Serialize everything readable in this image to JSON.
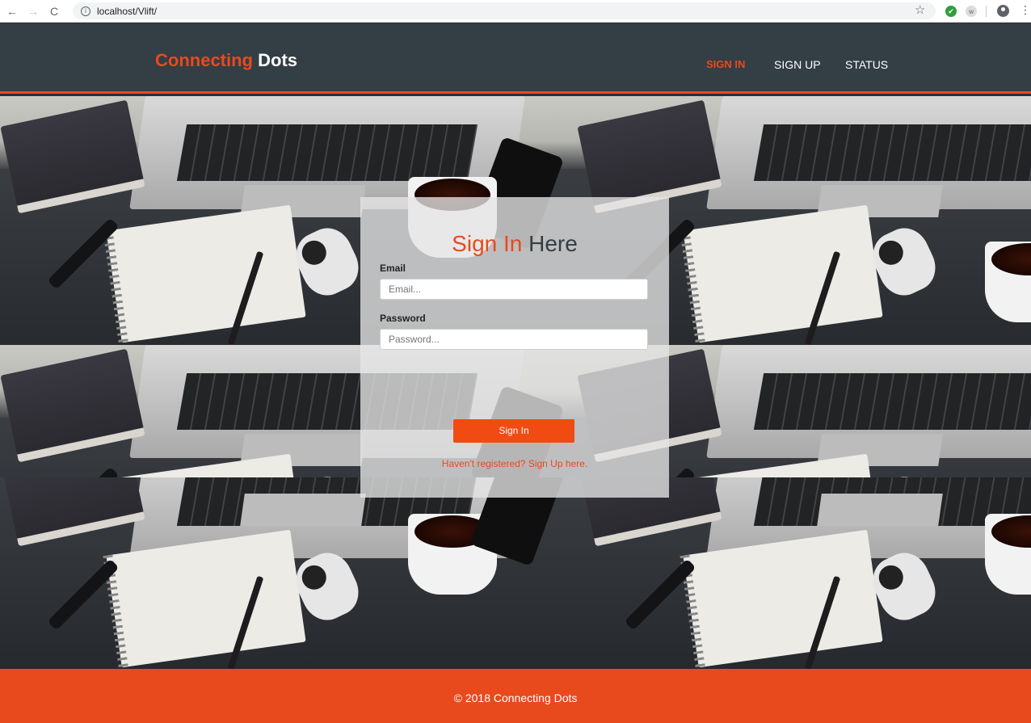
{
  "browser": {
    "url": "localhost/Vlift/",
    "back_icon": "←",
    "forward_icon": "→",
    "reload_icon": "C",
    "info_icon": "i",
    "star_icon": "☆",
    "ext_check_icon": "✔",
    "ext_w_label": "w",
    "menu_icon": "⋮"
  },
  "header": {
    "logo_part1": "Connecting",
    "logo_part2": "Dots",
    "nav": {
      "signin": "SIGN IN",
      "signup": "SIGN UP",
      "status": "STATUS"
    }
  },
  "login": {
    "title_accent": "Sign In",
    "title_rest": "Here",
    "email_label": "Email",
    "email_placeholder": "Email...",
    "password_label": "Password",
    "password_placeholder": "Password...",
    "submit_label": "Sign In",
    "register_link": "Haven't registered? Sign Up here."
  },
  "footer": {
    "text": "© 2018 Connecting Dots"
  },
  "colors": {
    "accent": "#e84a1d",
    "header_bg": "#333e45",
    "footer_bg": "#e84a1d"
  }
}
